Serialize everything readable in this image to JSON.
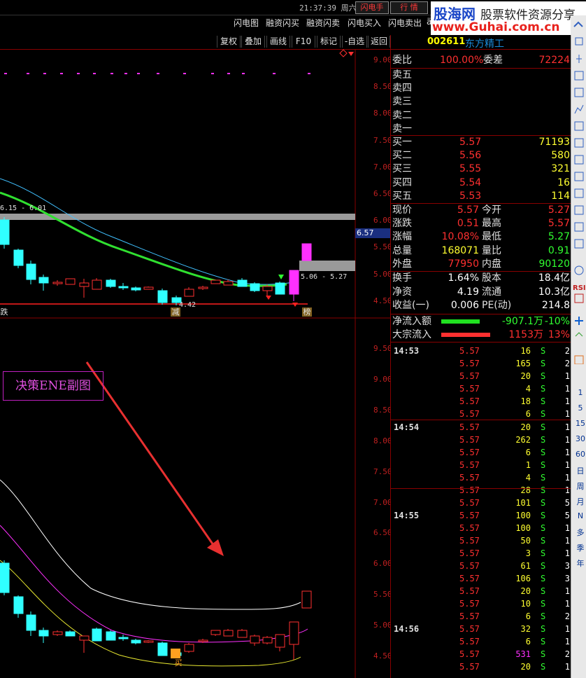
{
  "topbar": {
    "clock": "21:37:39 周六",
    "flash_btn": "闪电手",
    "quote_btn": "行 情"
  },
  "logo": {
    "line1": "股海网",
    "line1b": "股票软件资源分享",
    "line2": "www.Guhai.com.cn"
  },
  "menu": [
    "闪电图",
    "融资闪买",
    "融资闪卖",
    "闪电买入",
    "闪电卖出",
    "ä"
  ],
  "toolbar": [
    "复权",
    "叠加",
    "画线",
    "F10",
    "标记",
    "-自选",
    "返回"
  ],
  "main_chart": {
    "price_axis": [
      "9.00",
      "8.50",
      "8.00",
      "7.50",
      "7.00",
      "6.50",
      "6.00",
      "5.50",
      "5.00",
      "4.50"
    ],
    "current_price": "6.57",
    "range_left": "6.15 - 6.01",
    "range_right": "5.06 - 5.27",
    "low_label": "4.42",
    "tag_die": "跌",
    "tag_jian": "减",
    "tag_bang": "榜"
  },
  "sub_chart": {
    "title": "决策ENE副图",
    "price_axis": [
      "9.50",
      "9.00",
      "8.50",
      "8.00",
      "7.50",
      "7.00",
      "6.50",
      "6.00",
      "5.50",
      "5.00",
      "4.50"
    ],
    "buy_tag": "买"
  },
  "colors": {
    "up": "#ff3030",
    "down": "#30ffff",
    "ma_green": "#30e030",
    "ma_blue": "#40c0ff",
    "ene_upper": "#ffffff",
    "ene_mid": "#ff30ff",
    "ene_lower": "#ffff30"
  },
  "stock": {
    "code": "002611",
    "name": "东方精工"
  },
  "order_ratio": {
    "label": "委比",
    "value": "100.00%",
    "diff_label": "委差",
    "diff_value": "72224"
  },
  "asks": [
    {
      "label": "卖五",
      "price": "",
      "vol": ""
    },
    {
      "label": "卖四",
      "price": "",
      "vol": ""
    },
    {
      "label": "卖三",
      "price": "",
      "vol": ""
    },
    {
      "label": "卖二",
      "price": "",
      "vol": ""
    },
    {
      "label": "卖一",
      "price": "",
      "vol": ""
    }
  ],
  "bids": [
    {
      "label": "买一",
      "price": "5.57",
      "vol": "71193"
    },
    {
      "label": "买二",
      "price": "5.56",
      "vol": "580"
    },
    {
      "label": "买三",
      "price": "5.55",
      "vol": "321"
    },
    {
      "label": "买四",
      "price": "5.54",
      "vol": "16"
    },
    {
      "label": "买五",
      "price": "5.53",
      "vol": "114"
    }
  ],
  "quote": [
    {
      "l1": "现价",
      "v1": "5.57",
      "l2": "今开",
      "v2": "5.27"
    },
    {
      "l1": "涨跌",
      "v1": "0.51",
      "l2": "最高",
      "v2": "5.57"
    },
    {
      "l1": "涨幅",
      "v1": "10.08%",
      "l2": "最低",
      "v2": "5.27"
    },
    {
      "l1": "总量",
      "v1": "168071",
      "l2": "量比",
      "v2": "0.91"
    },
    {
      "l1": "外盘",
      "v1": "77950",
      "l2": "内盘",
      "v2": "90120"
    }
  ],
  "finance": [
    {
      "l1": "换手",
      "v1": "1.64%",
      "l2": "股本",
      "v2": "18.4亿"
    },
    {
      "l1": "净资",
      "v1": "4.19",
      "l2": "流通",
      "v2": "10.3亿"
    },
    {
      "l1": "收益(一)",
      "v1": "0.006",
      "l2": "PE(动)",
      "v2": "214.8"
    }
  ],
  "flow": [
    {
      "label": "净流入额",
      "value": "-907.1万",
      "pct": "-10%",
      "bar": 0.55
    },
    {
      "label": "大宗流入",
      "value": "1153万",
      "pct": "13%",
      "bar": 0.7
    }
  ],
  "ticks": [
    {
      "time": "14:53",
      "price": "5.57",
      "vol": "16",
      "side": "S",
      "n": "2"
    },
    {
      "time": "",
      "price": "5.57",
      "vol": "165",
      "side": "S",
      "n": "2"
    },
    {
      "time": "",
      "price": "5.57",
      "vol": "20",
      "side": "S",
      "n": "1"
    },
    {
      "time": "",
      "price": "5.57",
      "vol": "4",
      "side": "S",
      "n": "1"
    },
    {
      "time": "",
      "price": "5.57",
      "vol": "18",
      "side": "S",
      "n": "1"
    },
    {
      "time": "",
      "price": "5.57",
      "vol": "6",
      "side": "S",
      "n": "1"
    },
    {
      "time": "14:54",
      "price": "5.57",
      "vol": "20",
      "side": "S",
      "n": "1"
    },
    {
      "time": "",
      "price": "5.57",
      "vol": "262",
      "side": "S",
      "n": "1"
    },
    {
      "time": "",
      "price": "5.57",
      "vol": "6",
      "side": "S",
      "n": "1"
    },
    {
      "time": "",
      "price": "5.57",
      "vol": "1",
      "side": "S",
      "n": "1"
    },
    {
      "time": "",
      "price": "5.57",
      "vol": "4",
      "side": "S",
      "n": "1"
    },
    {
      "time": "",
      "price": "5.57",
      "vol": "28",
      "side": "S",
      "n": "1"
    },
    {
      "time": "",
      "price": "5.57",
      "vol": "101",
      "side": "S",
      "n": "5"
    },
    {
      "time": "14:55",
      "price": "5.57",
      "vol": "100",
      "side": "S",
      "n": "5"
    },
    {
      "time": "",
      "price": "5.57",
      "vol": "100",
      "side": "S",
      "n": "1"
    },
    {
      "time": "",
      "price": "5.57",
      "vol": "50",
      "side": "S",
      "n": "1"
    },
    {
      "time": "",
      "price": "5.57",
      "vol": "3",
      "side": "S",
      "n": "1"
    },
    {
      "time": "",
      "price": "5.57",
      "vol": "61",
      "side": "S",
      "n": "3"
    },
    {
      "time": "",
      "price": "5.57",
      "vol": "106",
      "side": "S",
      "n": "3"
    },
    {
      "time": "",
      "price": "5.57",
      "vol": "20",
      "side": "S",
      "n": "1"
    },
    {
      "time": "",
      "price": "5.57",
      "vol": "10",
      "side": "S",
      "n": "1"
    },
    {
      "time": "",
      "price": "5.57",
      "vol": "6",
      "side": "S",
      "n": "2"
    },
    {
      "time": "14:56",
      "price": "5.57",
      "vol": "32",
      "side": "S",
      "n": "1"
    },
    {
      "time": "",
      "price": "5.57",
      "vol": "6",
      "side": "S",
      "n": "1"
    },
    {
      "time": "",
      "price": "5.57",
      "vol": "531",
      "side": "S",
      "n": "2"
    },
    {
      "time": "",
      "price": "5.57",
      "vol": "20",
      "side": "S",
      "n": "1"
    }
  ],
  "sidebar_periods": [
    "1",
    "5",
    "15",
    "30",
    "60",
    "日",
    "周",
    "月",
    "N",
    "多",
    "季",
    "年"
  ],
  "sidebar_rsi": "RSI"
}
